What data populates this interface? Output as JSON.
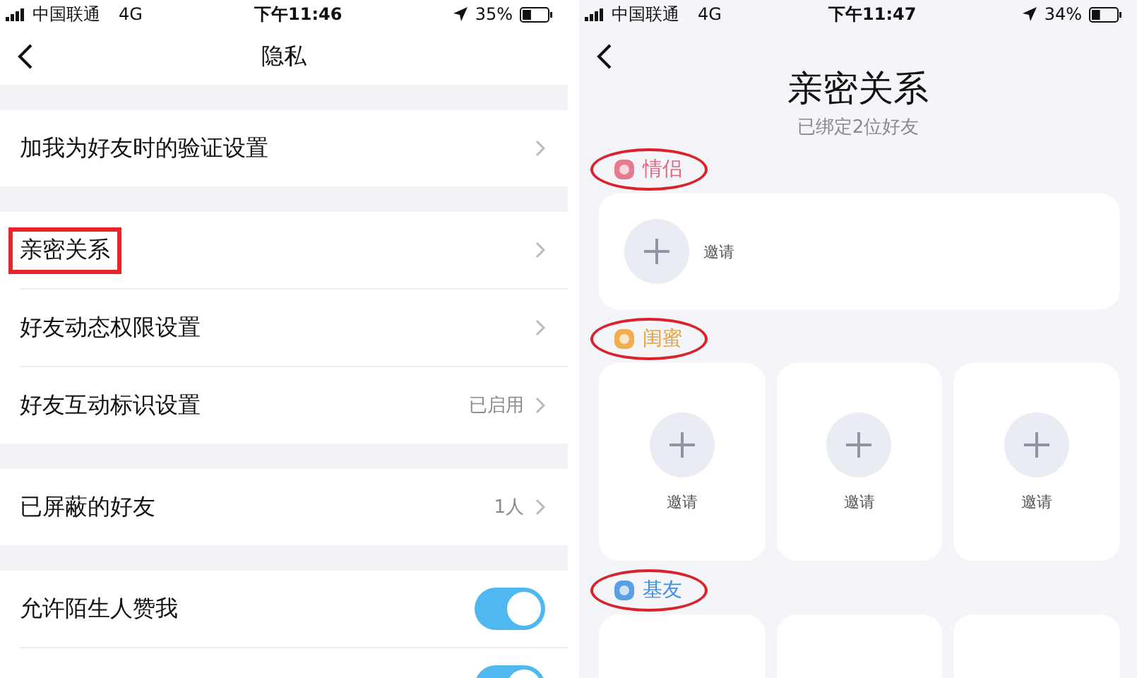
{
  "left_screen": {
    "status_bar": {
      "carrier": "中国联通",
      "network": "4G",
      "time": "下午11:46",
      "battery": "35%"
    },
    "nav": {
      "title": "隐私"
    },
    "groups": [
      {
        "rows": [
          {
            "kind": "link",
            "label": "加我为好友时的验证设置",
            "highlighted": false
          }
        ]
      },
      {
        "rows": [
          {
            "kind": "link",
            "label": "亲密关系",
            "highlighted": true
          },
          {
            "kind": "link",
            "label": "好友动态权限设置",
            "highlighted": false
          },
          {
            "kind": "link",
            "label": "好友互动标识设置",
            "value": "已启用",
            "highlighted": false
          }
        ]
      },
      {
        "rows": [
          {
            "kind": "link",
            "label": "已屏蔽的好友",
            "value": "1人",
            "highlighted": false
          }
        ]
      },
      {
        "rows": [
          {
            "kind": "toggle",
            "label": "允许陌生人赞我",
            "on": true,
            "highlighted": false
          },
          {
            "kind": "toggle",
            "on": true,
            "highlighted": false
          }
        ]
      }
    ]
  },
  "right_screen": {
    "status_bar": {
      "carrier": "中国联通",
      "network": "4G",
      "time": "下午11:47",
      "battery": "34%"
    },
    "title": "亲密关系",
    "subtitle": "已绑定2位好友",
    "sections": [
      {
        "label": "情侣",
        "kind": "wide",
        "color": "#e2647e",
        "circled": true,
        "slots": [
          "邀请"
        ]
      },
      {
        "label": "闺蜜",
        "kind": "grid",
        "color": "#f0a030",
        "circled": true,
        "slots": [
          "邀请",
          "邀请",
          "邀请"
        ]
      },
      {
        "label": "基友",
        "kind": "grid",
        "color": "#3d8fe0",
        "circled": true
      }
    ]
  }
}
